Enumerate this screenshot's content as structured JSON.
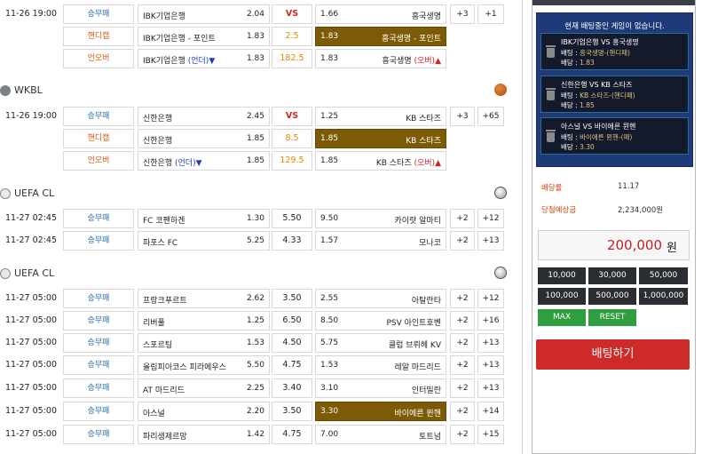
{
  "groups": [
    {
      "title": "",
      "sport": "volleyball",
      "rows": [
        {
          "time": "11-26 19:00",
          "type": "승무패",
          "home": "IBK기업은행",
          "home_odds": "2.04",
          "draw": "VS",
          "away_odds": "1.66",
          "away": "흥국생명",
          "p1": "+3",
          "p2": "+1"
        },
        {
          "time": "",
          "type": "핸디캡",
          "home": "IBK기업은행 - 포인트",
          "home_odds": "1.83",
          "draw": "2.5",
          "away_odds": "1.83",
          "away": "흥국생명 - 포인트",
          "selected": "away"
        },
        {
          "time": "",
          "type": "언오버",
          "home": "IBK기업은행",
          "under": "(언더)▼",
          "home_odds": "1.83",
          "draw": "182.5",
          "away_odds": "1.83",
          "away": "흥국생명",
          "over": "(오버)▲"
        }
      ]
    },
    {
      "title": "WKBL",
      "sport": "basketball",
      "rows": [
        {
          "time": "11-26 19:00",
          "type": "승무패",
          "home": "신한은행",
          "home_odds": "2.45",
          "draw": "VS",
          "away_odds": "1.25",
          "away": "KB 스타즈",
          "p1": "+3",
          "p2": "+65"
        },
        {
          "time": "",
          "type": "핸디캡",
          "home": "신한은행",
          "home_odds": "1.85",
          "draw": "8.5",
          "away_odds": "1.85",
          "away": "KB 스타즈",
          "selected": "away"
        },
        {
          "time": "",
          "type": "언오버",
          "home": "신한은행",
          "under": "(언더)▼",
          "home_odds": "1.85",
          "draw": "129.5",
          "away_odds": "1.85",
          "away": "KB 스타즈",
          "over": "(오버)▲"
        }
      ]
    },
    {
      "title": "UEFA CL",
      "sport": "soccer",
      "rows": [
        {
          "time": "11-27 02:45",
          "type": "승무패",
          "home": "FC 코펜하겐",
          "home_odds": "1.30",
          "draw": "5.50",
          "away_odds": "9.50",
          "away": "카이랏 알마티",
          "p1": "+2",
          "p2": "+12"
        },
        {
          "time": "11-27 02:45",
          "type": "승무패",
          "home": "파포스 FC",
          "home_odds": "5.25",
          "draw": "4.33",
          "away_odds": "1.57",
          "away": "모나코",
          "p1": "+2",
          "p2": "+13"
        }
      ]
    },
    {
      "title": "UEFA CL",
      "sport": "soccer",
      "rows": [
        {
          "time": "11-27 05:00",
          "type": "승무패",
          "home": "프랑크푸르트",
          "home_odds": "2.62",
          "draw": "3.50",
          "away_odds": "2.55",
          "away": "아탈란타",
          "p1": "+2",
          "p2": "+12"
        },
        {
          "time": "11-27 05:00",
          "type": "승무패",
          "home": "리버풀",
          "home_odds": "1.25",
          "draw": "6.50",
          "away_odds": "8.50",
          "away": "PSV 아인트호벤",
          "p1": "+2",
          "p2": "+16"
        },
        {
          "time": "11-27 05:00",
          "type": "승무패",
          "home": "스포르팅",
          "home_odds": "1.53",
          "draw": "4.50",
          "away_odds": "5.75",
          "away": "클럽 브뤼헤 KV",
          "p1": "+2",
          "p2": "+13"
        },
        {
          "time": "11-27 05:00",
          "type": "승무패",
          "home": "올림피아코스 피라에우스",
          "home_odds": "5.50",
          "draw": "4.75",
          "away_odds": "1.53",
          "away": "레알 마드리드",
          "p1": "+2",
          "p2": "+13"
        },
        {
          "time": "11-27 05:00",
          "type": "승무패",
          "home": "AT 마드리드",
          "home_odds": "2.25",
          "draw": "3.40",
          "away_odds": "3.10",
          "away": "인터밀란",
          "p1": "+2",
          "p2": "+13"
        },
        {
          "time": "11-27 05:00",
          "type": "승무패",
          "home": "아스널",
          "home_odds": "2.20",
          "draw": "3.50",
          "away_odds": "3.30",
          "away": "바이에른 뮌헨",
          "p1": "+2",
          "p2": "+14",
          "selected": "away"
        },
        {
          "time": "11-27 05:00",
          "type": "승무패",
          "home": "파리생제르망",
          "home_odds": "1.42",
          "draw": "4.75",
          "away_odds": "7.00",
          "away": "토트넘",
          "p1": "+2",
          "p2": "+15"
        }
      ]
    }
  ],
  "betslip": {
    "notice": "현재 배팅중인 게임이 없습니다.",
    "bets": [
      {
        "title": "IBK기업은행 VS 흥국생명",
        "bet_label": "배팅 :",
        "bet_value": "흥국생명-(핸디패)",
        "odds_label": "배당 :",
        "odds_value": "1.83"
      },
      {
        "title": "신한은행 VS KB 스타즈",
        "bet_label": "배팅 :",
        "bet_value": "KB 스타즈-(핸디패)",
        "odds_label": "배당 :",
        "odds_value": "1.85"
      },
      {
        "title": "아스널 VS 바이에른 뮌헨",
        "bet_label": "배팅 :",
        "bet_value": "바이에른 뮌헨-(패)",
        "odds_label": "배당 :",
        "odds_value": "3.30"
      }
    ],
    "odds_label": "배당률",
    "odds_total": "11.17",
    "payout_label": "당첨예상금",
    "payout_value": "2,234,000원",
    "amount": "200,000",
    "amount_unit": "원",
    "chips": [
      "10,000",
      "30,000",
      "50,000",
      "100,000",
      "500,000",
      "1,000,000"
    ],
    "max_label": "MAX",
    "reset_label": "RESET",
    "bet_button": "배팅하기"
  },
  "colors": {
    "selected_odds": "#7d5a05",
    "bet_button": "#cf2a2a",
    "slip_bg": "#1f3a78"
  }
}
